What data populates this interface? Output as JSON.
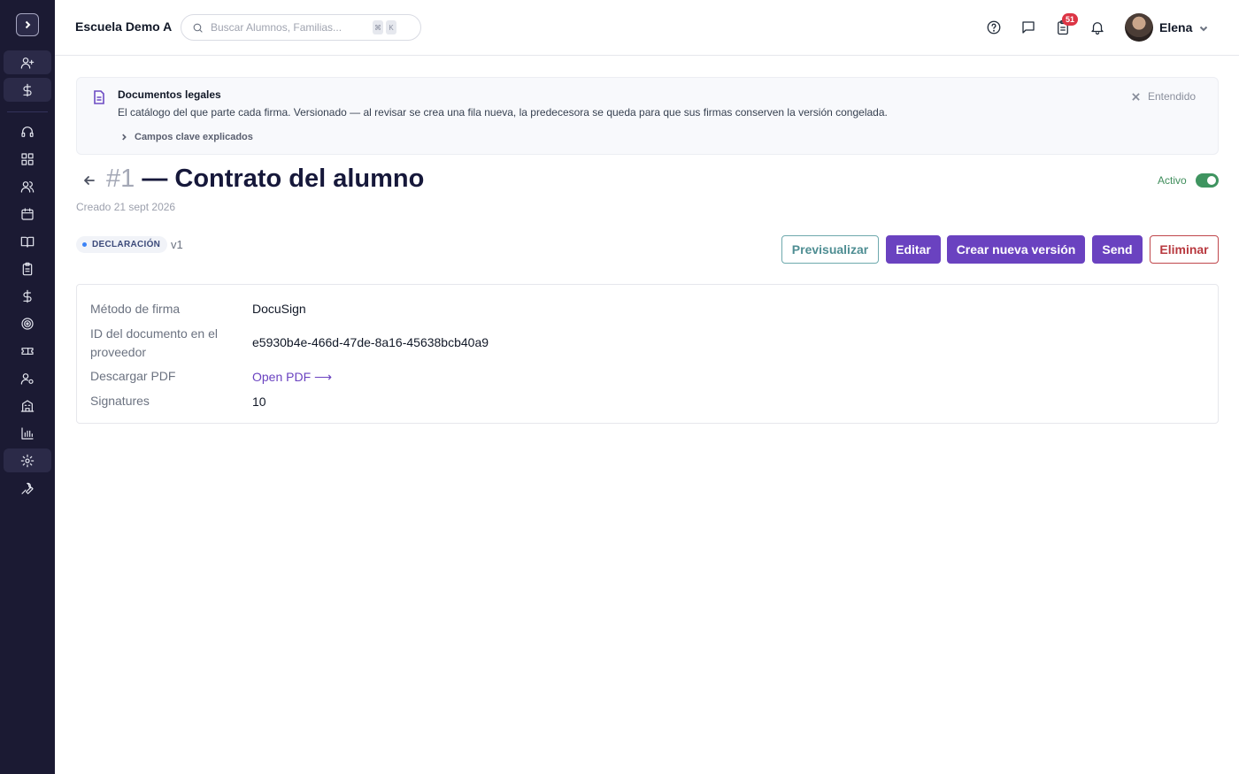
{
  "header": {
    "school_name": "Escuela Demo A",
    "search_placeholder": "Buscar Alumnos, Familias...",
    "search_shortcut": [
      "⌘",
      "K"
    ],
    "tasks_badge": "51",
    "user_name": "Elena"
  },
  "sidebar": {
    "items": [
      "add-user",
      "dollar",
      "headset",
      "dashboard",
      "users",
      "calendar",
      "book",
      "clipboard",
      "billing",
      "target",
      "ticket",
      "user-settings",
      "building",
      "chart",
      "settings",
      "wrench"
    ],
    "active": "settings"
  },
  "banner": {
    "title": "Documentos legales",
    "text": "El catálogo del que parte cada firma. Versionado — al revisar se crea una fila nueva, la predecesora se queda para que sus firmas conserven la versión congelada.",
    "more_label": "Campos clave explicados",
    "dismiss_label": "Entendido"
  },
  "document": {
    "number": "#1",
    "title": "— Contrato del alumno",
    "created": "Creado 21 sept 2026",
    "status_label": "Activo",
    "active": true,
    "type_tag": "DECLARACIÓN",
    "version": "v1"
  },
  "actions": {
    "preview": "Previsualizar",
    "edit": "Editar",
    "new_version": "Crear nueva versión",
    "send": "Send",
    "delete": "Eliminar"
  },
  "details": {
    "signature_method_label": "Método de firma",
    "signature_method_value": "DocuSign",
    "provider_id_label": "ID del documento en el proveedor",
    "provider_id_value": "e5930b4e-466d-47de-8a16-45638bcb40a9",
    "download_label": "Descargar PDF",
    "download_link": "Open PDF ⟶",
    "signatures_label": "Signatures",
    "signatures_value": "10"
  },
  "colors": {
    "sidebar_bg": "#1b1a33",
    "primary": "#6a42c0",
    "outline": "#4f8e93",
    "danger": "#b8393f",
    "active_green": "#3f9460",
    "badge_red": "#dc3545"
  }
}
